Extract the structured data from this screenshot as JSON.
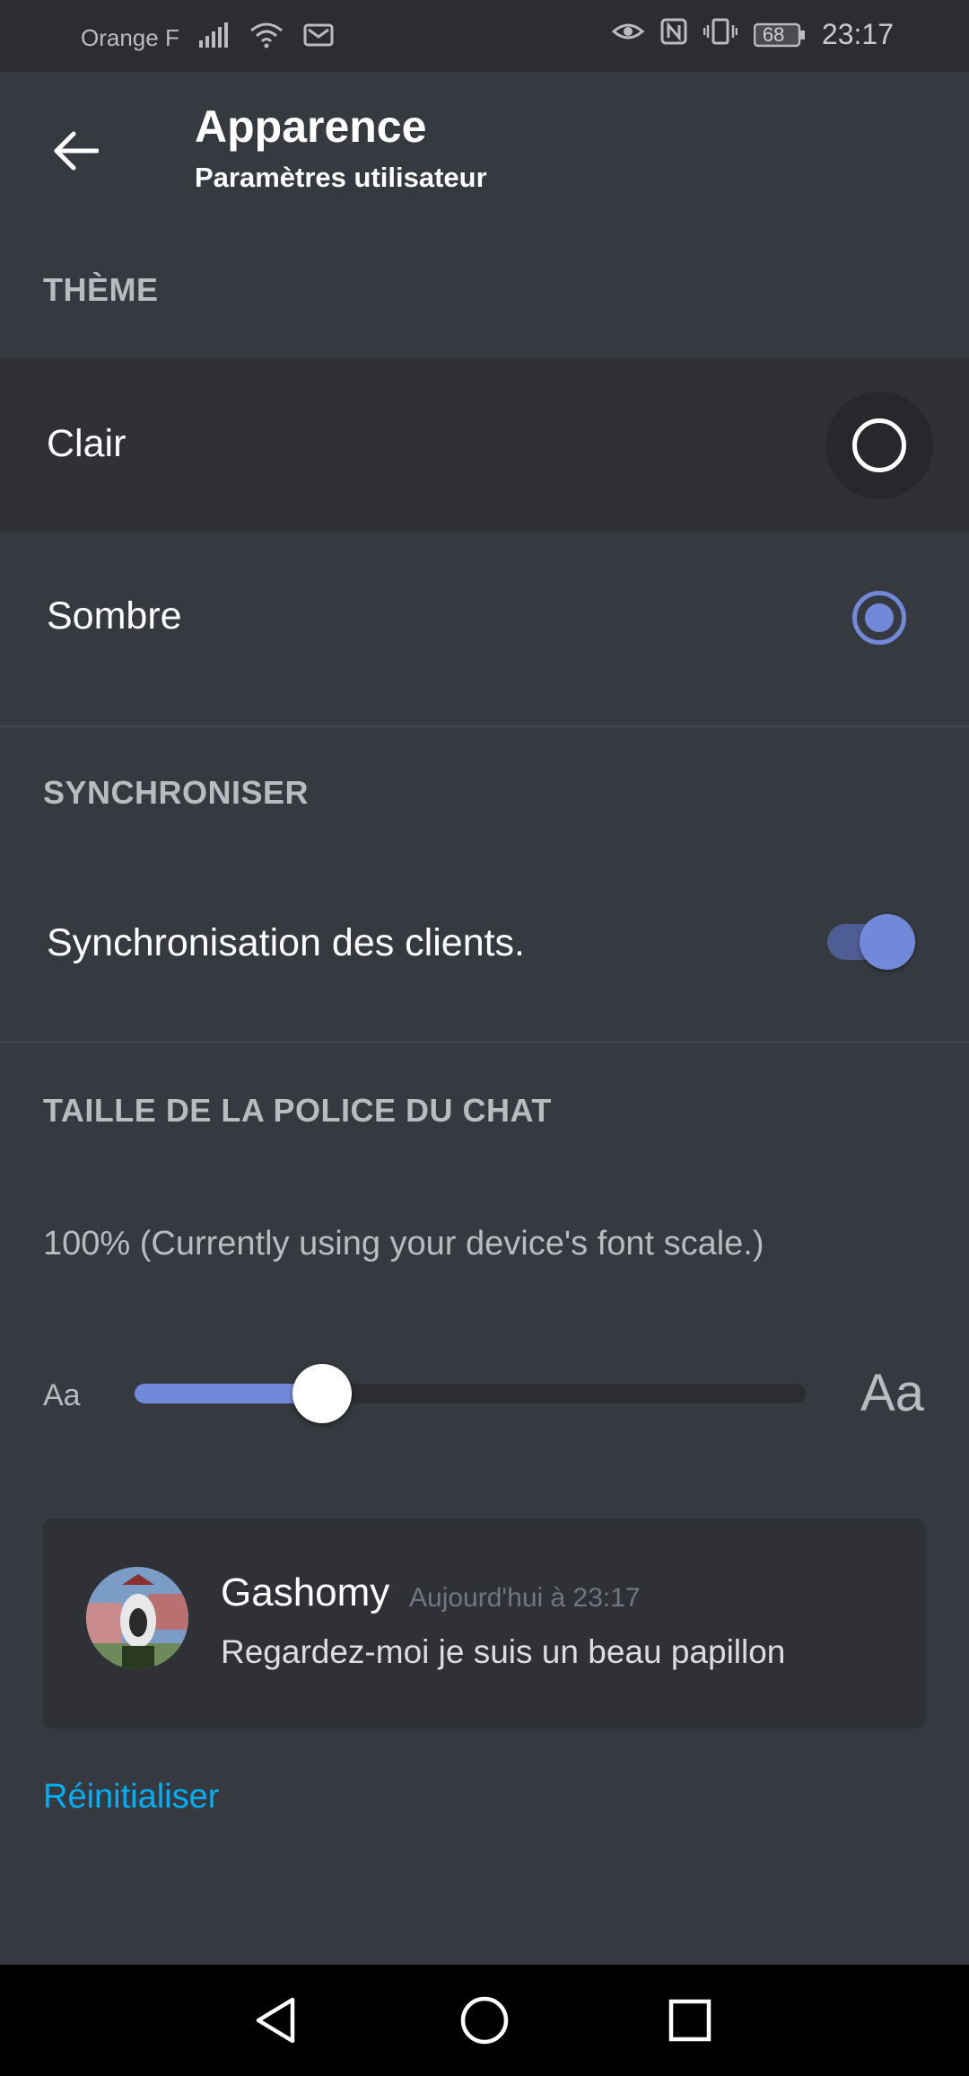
{
  "status_bar": {
    "carrier": "Orange F",
    "battery": "68",
    "time": "23:17"
  },
  "header": {
    "title": "Apparence",
    "subtitle": "Paramètres utilisateur"
  },
  "theme": {
    "section_title": "THÈME",
    "options": [
      {
        "label": "Clair",
        "selected": false
      },
      {
        "label": "Sombre",
        "selected": true
      }
    ]
  },
  "sync": {
    "section_title": "SYNCHRONISER",
    "label": "Synchronisation des clients.",
    "enabled": true
  },
  "font_size": {
    "section_title": "TAILLE DE LA POLICE DU CHAT",
    "description": "100% (Currently using your device's font scale.)",
    "small_label": "Aa",
    "large_label": "Aa",
    "slider_fraction": 0.28
  },
  "preview": {
    "username": "Gashomy",
    "timestamp": "Aujourd'hui à 23:17",
    "message": "Regardez-moi je suis un beau papillon"
  },
  "reset_label": "Réinitialiser",
  "colors": {
    "background": "#36393f",
    "accent": "#7289da",
    "link": "#00b0f4"
  }
}
